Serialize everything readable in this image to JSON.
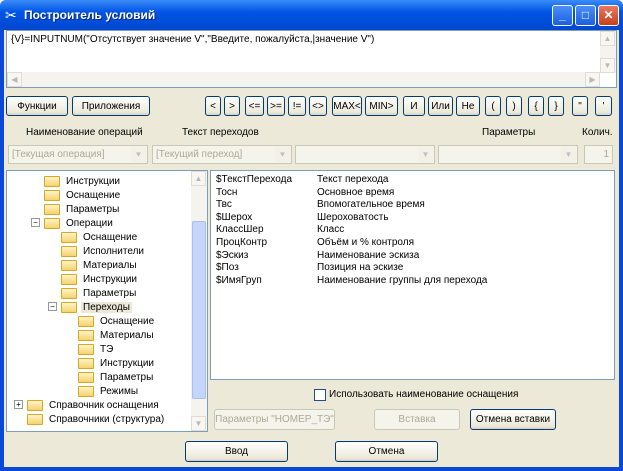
{
  "window": {
    "title": "Построитель условий",
    "accent": "#0a48d8"
  },
  "editor": {
    "value": "{V}=INPUTNUM(\"Отсутствует значение V\",\"Введите, пожалуйста,|значение V\")"
  },
  "toolbar": {
    "functions": "Функции",
    "applications": "Приложения",
    "operators": [
      "<",
      ">",
      "<=",
      ">=",
      "!=",
      "<>",
      "MAX<",
      "MIN>",
      "И",
      "Или",
      "Не",
      "(",
      ")",
      "{",
      "}",
      "\"",
      "'"
    ]
  },
  "filters": {
    "labels": {
      "operation": "Наименование операций",
      "transition": "Текст переходов",
      "params": "Параметры",
      "qty": "Колич."
    },
    "operation": "[Текущая операция]",
    "transition": "[Текущий переход]",
    "param1": "",
    "param2": "",
    "qty": "1"
  },
  "tree": [
    {
      "label": "Инструкции",
      "level": 2
    },
    {
      "label": "Оснащение",
      "level": 2
    },
    {
      "label": "Параметры",
      "level": 2
    },
    {
      "label": "Операции",
      "level": 2,
      "expanded": true
    },
    {
      "label": "Оснащение",
      "level": 3
    },
    {
      "label": "Исполнители",
      "level": 3
    },
    {
      "label": "Материалы",
      "level": 3
    },
    {
      "label": "Инструкции",
      "level": 3
    },
    {
      "label": "Параметры",
      "level": 3
    },
    {
      "label": "Переходы",
      "level": 3,
      "expanded": true,
      "selected": true
    },
    {
      "label": "Оснащение",
      "level": 4
    },
    {
      "label": "Материалы",
      "level": 4
    },
    {
      "label": "ТЭ",
      "level": 4
    },
    {
      "label": "Инструкции",
      "level": 4
    },
    {
      "label": "Параметры",
      "level": 4
    },
    {
      "label": "Режимы",
      "level": 4
    },
    {
      "label": "Справочник оснащения",
      "level": 1,
      "collapsed": true
    },
    {
      "label": "Справочники (структура)",
      "level": 1
    }
  ],
  "variables": [
    {
      "name": "$ТекстПерехода",
      "desc": "Текст перехода"
    },
    {
      "name": "Тосн",
      "desc": "Основное время"
    },
    {
      "name": "Твс",
      "desc": "Впомогательное время"
    },
    {
      "name": "$Шерох",
      "desc": "Шероховатость"
    },
    {
      "name": "КлассШер",
      "desc": "Класс"
    },
    {
      "name": "ПроцКонтр",
      "desc": "Объём и % контроля"
    },
    {
      "name": "$Эскиз",
      "desc": "Наименование эскиза"
    },
    {
      "name": "$Поз",
      "desc": "Позиция на эскизе"
    },
    {
      "name": "$ИмяГруп",
      "desc": "Наименование группы для перехода"
    }
  ],
  "options": {
    "use_equipment_name": "Использовать наименование оснащения",
    "use_equipment_name_checked": false
  },
  "actions": {
    "params_te": "Параметры \"НОМЕР_ТЭ\"",
    "insert": "Вставка",
    "cancel_insert": "Отмена вставки",
    "ok": "Ввод",
    "cancel": "Отмена"
  }
}
